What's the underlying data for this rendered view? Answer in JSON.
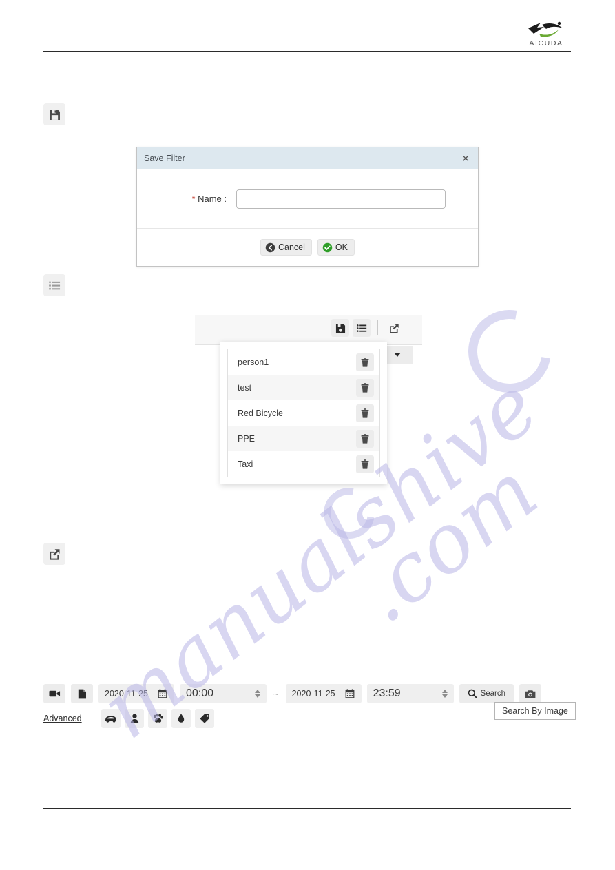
{
  "header": {
    "logo_text": "AICUDA",
    "logo_icon": "aicuda-swoosh-logo"
  },
  "watermark": {
    "line1": "manualshive",
    "line2": ".com"
  },
  "markers": [
    {
      "icon": "save-icon",
      "name": "save-filter-marker"
    },
    {
      "icon": "list-icon",
      "name": "filter-list-marker"
    },
    {
      "icon": "export-icon",
      "name": "export-marker"
    }
  ],
  "dialog": {
    "title": "Save Filter",
    "close_icon": "close-icon",
    "field_label": "Name :",
    "required_marker": "*",
    "name_value": "",
    "name_placeholder": "",
    "cancel_label": "Cancel",
    "ok_label": "OK",
    "cancel_icon": "back-circle-icon",
    "ok_icon": "check-circle-icon",
    "title_bg": "#dde8ef"
  },
  "filter_popup": {
    "toolbar": {
      "save_icon": "save-icon",
      "list_icon": "list-icon",
      "export_icon": "export-icon",
      "caret_icon": "chevron-down-icon"
    },
    "items": [
      {
        "name": "person1",
        "delete_icon": "trash-icon"
      },
      {
        "name": "test",
        "delete_icon": "trash-icon"
      },
      {
        "name": "Red Bicycle",
        "delete_icon": "trash-icon"
      },
      {
        "name": "PPE",
        "delete_icon": "trash-icon"
      },
      {
        "name": "Taxi",
        "delete_icon": "trash-icon"
      }
    ]
  },
  "search_toolbar": {
    "video_icon": "video-camera-icon",
    "file_icon": "document-icon",
    "start_date": "2020-11-25",
    "start_time": "00:00",
    "range_separator": "~",
    "end_date": "2020-11-25",
    "end_time": "23:59",
    "calendar_icon": "calendar-icon",
    "search_label": "Search",
    "search_icon": "search-icon",
    "camera_icon": "camera-icon",
    "tooltip": "Search By Image",
    "advanced_label": "Advanced",
    "categories": [
      {
        "icon": "car-icon",
        "name": "category-vehicle"
      },
      {
        "icon": "person-icon",
        "name": "category-person"
      },
      {
        "icon": "paw-icon",
        "name": "category-animal"
      },
      {
        "icon": "droplet-icon",
        "name": "category-liquid"
      },
      {
        "icon": "tag-icon",
        "name": "category-tag"
      }
    ]
  }
}
